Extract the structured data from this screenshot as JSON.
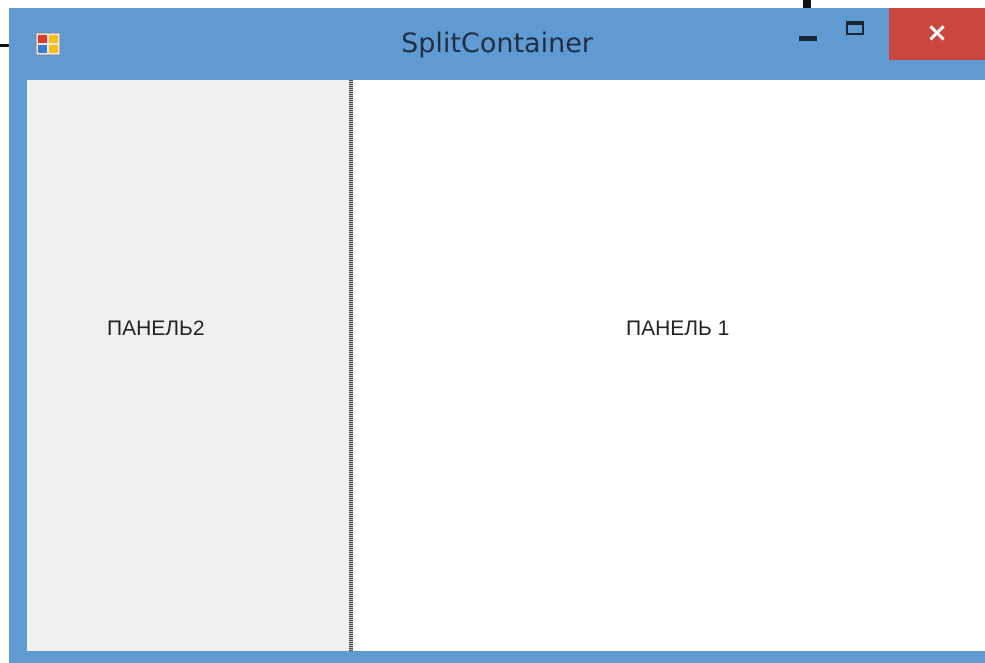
{
  "window": {
    "title": "SplitContainer",
    "close_glyph": "×",
    "icons": {
      "app": "app-icon",
      "minimize": "minimize-icon",
      "maximize": "maximize-icon",
      "close": "close-icon"
    }
  },
  "panels": {
    "left_label": "ПАНЕЛЬ2",
    "right_label": "ПАНЕЛЬ 1"
  },
  "colors": {
    "titlebar": "#5f9bd2",
    "close_button": "#c9473f",
    "left_panel": "#f0f0f0",
    "right_panel": "#ffffff"
  }
}
